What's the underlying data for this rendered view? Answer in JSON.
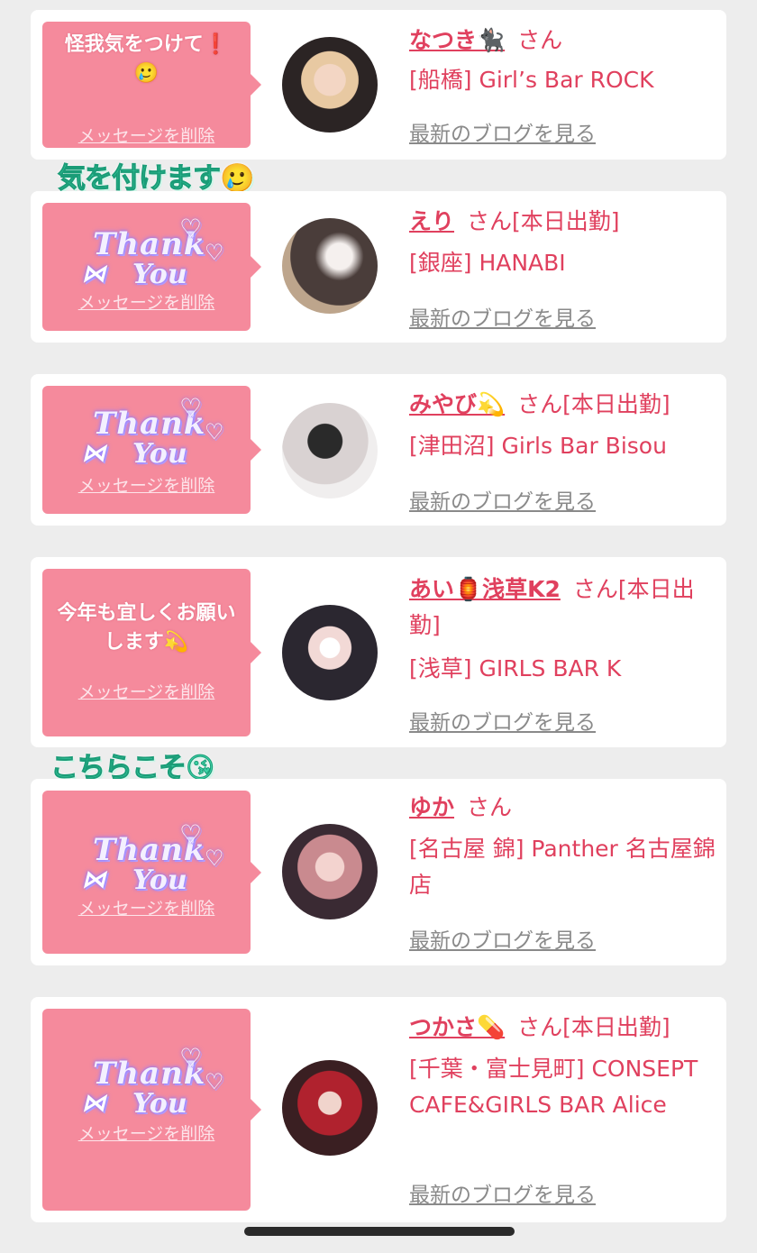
{
  "delete_label": "メッセージを削除",
  "blog_label": "最新のブログを見る",
  "san_label": "さん",
  "sticker_thank": "Thank",
  "sticker_you": "You",
  "cards": [
    {
      "message": "怪我気をつけて❗️ 🥲",
      "name": "なつき🐈‍⬛",
      "status": "",
      "shop": "[船橋] Girl’s Bar ROCK"
    },
    {
      "message": "",
      "name": "えり",
      "status": "[本日出勤]",
      "shop": "[銀座] HANABI"
    },
    {
      "message": "",
      "name": "みやび💫",
      "status": "[本日出勤]",
      "shop": "[津田沼] Girls Bar Bisou"
    },
    {
      "message": "今年も宜しくお願いします💫",
      "name": "あい🏮浅草K2",
      "status": "[本日出勤]",
      "shop": "[浅草] GIRLS BAR K"
    },
    {
      "message": "",
      "name": "ゆか",
      "status": "",
      "shop": "[名古屋 錦] Panther 名古屋錦店"
    },
    {
      "message": "",
      "name": "つかさ💊",
      "status": "[本日出勤]",
      "shop": "[千葉・富士見町] CONSEPT CAFE&GIRLS BAR Alice"
    }
  ],
  "overlay_stickers": [
    "気を付けます🥲",
    "こちらこそ😘"
  ],
  "colors": {
    "background": "#ededed",
    "bubble": "#f58a9c",
    "accent": "#e0405e",
    "sticker_green": "#3fd0a6"
  }
}
